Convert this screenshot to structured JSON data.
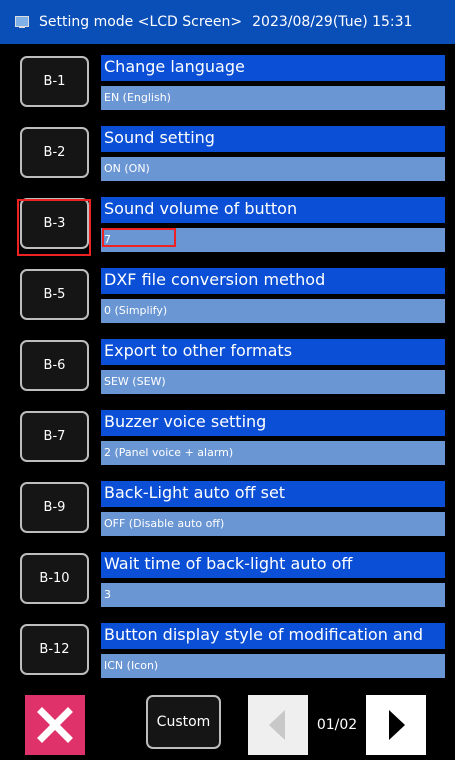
{
  "titlebar": {
    "icon": "monitor-icon",
    "title": "Setting mode <LCD Screen>",
    "datetime": "2023/08/29(Tue) 15:31"
  },
  "settings": [
    {
      "code": "B-1",
      "title": "Change language",
      "value": "EN (English)"
    },
    {
      "code": "B-2",
      "title": "Sound setting",
      "value": "ON (ON)"
    },
    {
      "code": "B-3",
      "title": "Sound volume of button",
      "value": "7"
    },
    {
      "code": "B-5",
      "title": "DXF file conversion method",
      "value": "0 (Simplify)"
    },
    {
      "code": "B-6",
      "title": "Export to other formats",
      "value": "SEW (SEW)"
    },
    {
      "code": "B-7",
      "title": "Buzzer voice setting",
      "value": "2 (Panel voice + alarm)"
    },
    {
      "code": "B-9",
      "title": "Back-Light auto off set",
      "value": "OFF (Disable auto off)"
    },
    {
      "code": "B-10",
      "title": "Wait time of back-light auto off",
      "value": "3"
    },
    {
      "code": "B-12",
      "title": "Button display style of modification and",
      "value": "ICN (Icon)"
    }
  ],
  "footer": {
    "close_icon": "close-icon",
    "custom_label": "Custom",
    "prev_icon": "left-arrow-icon",
    "page": "01/02",
    "next_icon": "right-arrow-icon"
  },
  "colors": {
    "titlebar_bg": "#0a4fb8",
    "row_title_bg": "#0a4fd6",
    "row_value_bg": "#6b96d4",
    "close_bg": "#e0326a",
    "highlight": "#ee2222"
  }
}
